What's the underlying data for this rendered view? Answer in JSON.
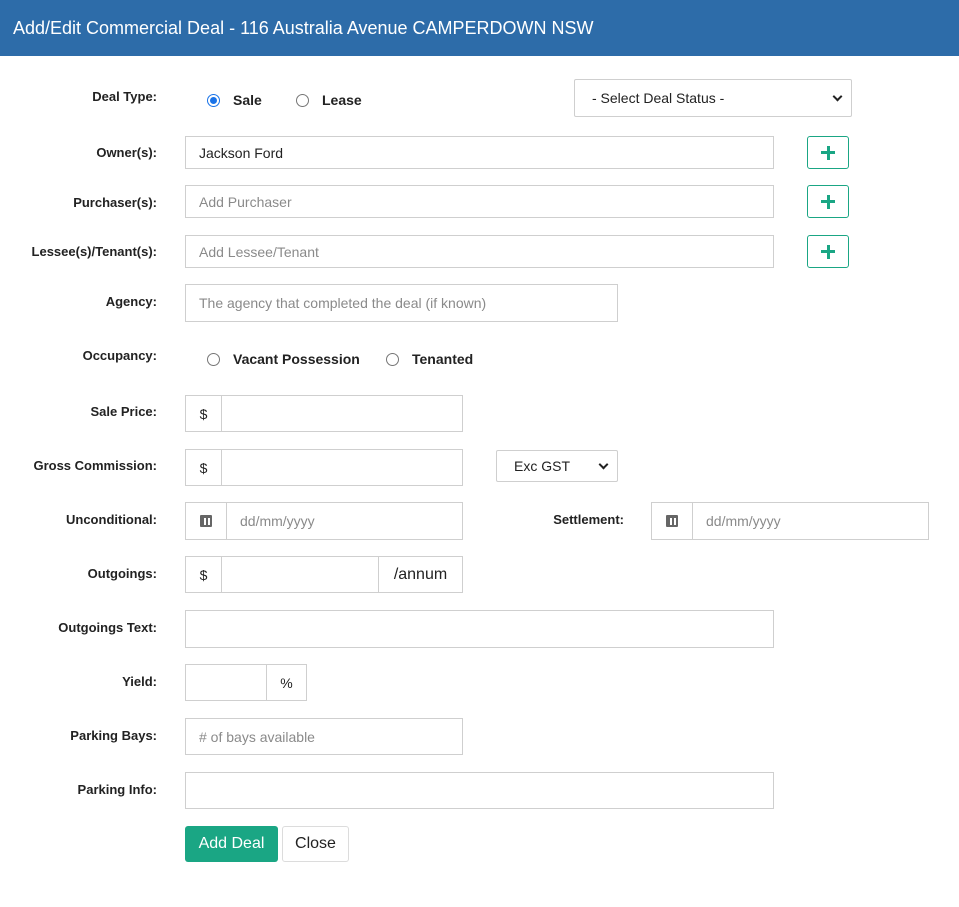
{
  "header": {
    "title": "Add/Edit Commercial Deal - 116 Australia Avenue CAMPERDOWN NSW"
  },
  "labels": {
    "deal_type": "Deal Type:",
    "owners": "Owner(s):",
    "purchasers": "Purchaser(s):",
    "lessees": "Lessee(s)/Tenant(s):",
    "agency": "Agency:",
    "occupancy": "Occupancy:",
    "sale_price": "Sale Price:",
    "gross_commission": "Gross Commission:",
    "unconditional": "Unconditional:",
    "settlement": "Settlement:",
    "outgoings": "Outgoings:",
    "outgoings_text": "Outgoings Text:",
    "yield": "Yield:",
    "parking_bays": "Parking Bays:",
    "parking_info": "Parking Info:"
  },
  "deal_type": {
    "options": [
      {
        "label": "Sale",
        "checked": true
      },
      {
        "label": "Lease",
        "checked": false
      }
    ],
    "status_select": "- Select Deal Status -"
  },
  "fields": {
    "owners_value": "Jackson Ford",
    "purchasers_placeholder": "Add Purchaser",
    "lessees_placeholder": "Add Lessee/Tenant",
    "agency_placeholder": "The agency that completed the deal (if known)",
    "sale_price_value": "",
    "gross_commission_value": "",
    "outgoings_value": "",
    "outgoings_text_value": "",
    "yield_value": "",
    "parking_bays_placeholder": "# of bays available",
    "parking_info_value": "",
    "date_placeholder": "dd/mm/yyyy"
  },
  "occupancy": {
    "options": [
      {
        "label": "Vacant Possession",
        "checked": false
      },
      {
        "label": "Tenanted",
        "checked": false
      }
    ]
  },
  "addons": {
    "currency": "$",
    "per_annum": "/annum",
    "percent": "%"
  },
  "gst_select": "Exc GST",
  "buttons": {
    "add_deal": "Add Deal",
    "close": "Close"
  },
  "colors": {
    "header_bg": "#2d6ca9",
    "accent": "#1aa684",
    "radio_selected": "#1a73e8"
  },
  "icons": {
    "add": "plus-icon",
    "date": "calendar-icon",
    "select": "chevron-down-icon"
  }
}
